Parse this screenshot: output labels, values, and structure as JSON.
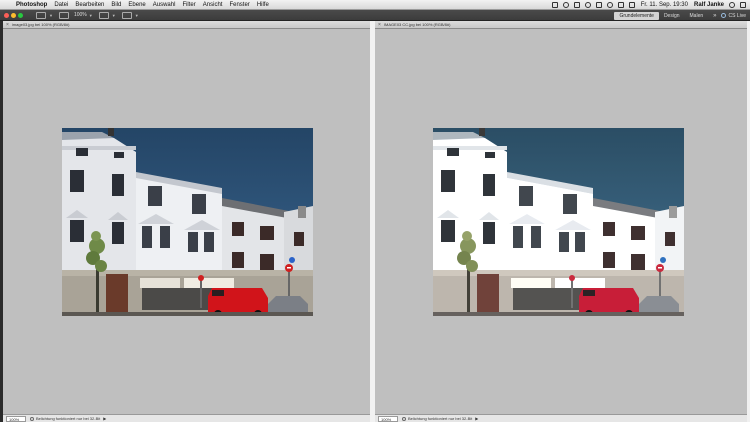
{
  "menubar": {
    "apple": "",
    "app": "Photoshop",
    "items": [
      "Datei",
      "Bearbeiten",
      "Bild",
      "Ebene",
      "Auswahl",
      "Filter",
      "Ansicht",
      "Fenster",
      "Hilfe"
    ],
    "clock": "Fr. 11. Sep. 19:30",
    "user": "Ralf Janke"
  },
  "optionsbar": {
    "zoom": "100%",
    "workspaces": [
      "Grundelemente",
      "Design",
      "Malen"
    ],
    "more": "»",
    "cc_label": "CS Live"
  },
  "documents": [
    {
      "tab_title": "image03.jpg bei 100% (RGB/8#)",
      "zoom": "100%",
      "status": "Belichtung funktioniert nur bei 32-Bit"
    },
    {
      "tab_title": "IMAGE03 CC.jpg bei 100% (RGB/8#)",
      "zoom": "100%",
      "status": "Belichtung funktioniert nur bei 32-Bit"
    }
  ],
  "colors": {
    "canvas_bg": "#bfbfbf",
    "sky": "#2e5178",
    "van": "#d1141a"
  }
}
